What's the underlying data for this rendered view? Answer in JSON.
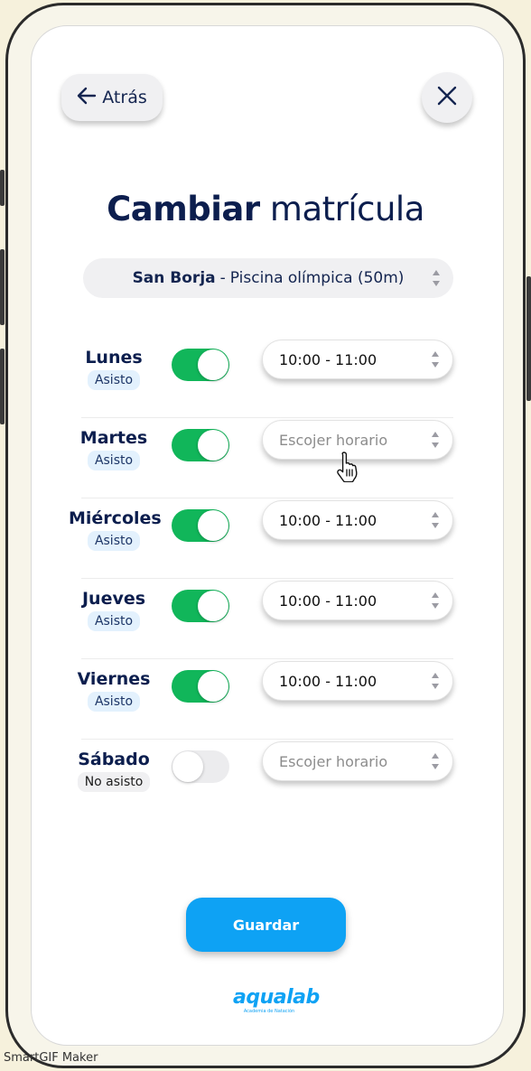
{
  "header": {
    "back_label": "Atrás",
    "back_icon": "arrow-left-icon",
    "close_icon": "close-icon"
  },
  "title": {
    "bold": "Cambiar",
    "regular": "matrícula"
  },
  "location": {
    "district": "San Borja",
    "separator": "-",
    "venue": "Piscina olímpica (50m)"
  },
  "days": [
    {
      "name": "Lunes",
      "status": "Asisto",
      "enabled": true,
      "schedule": "10:00 - 11:00"
    },
    {
      "name": "Martes",
      "status": "Asisto",
      "enabled": true,
      "schedule": "Escojer horario"
    },
    {
      "name": "Miércoles",
      "status": "Asisto",
      "enabled": true,
      "schedule": "10:00 - 11:00"
    },
    {
      "name": "Jueves",
      "status": "Asisto",
      "enabled": true,
      "schedule": "10:00 - 11:00"
    },
    {
      "name": "Viernes",
      "status": "Asisto",
      "enabled": true,
      "schedule": "10:00 - 11:00"
    },
    {
      "name": "Sábado",
      "status": "No asisto",
      "enabled": false,
      "schedule": "Escojer horario"
    }
  ],
  "save_label": "Guardar",
  "logo": {
    "word": "aqualab",
    "sub": "Academia de Natación"
  },
  "watermark": "SmartGIF Maker",
  "colors": {
    "primary": "#0ea2f4",
    "toggle_on": "#11b65a",
    "text_dark": "#0c1e4e"
  }
}
